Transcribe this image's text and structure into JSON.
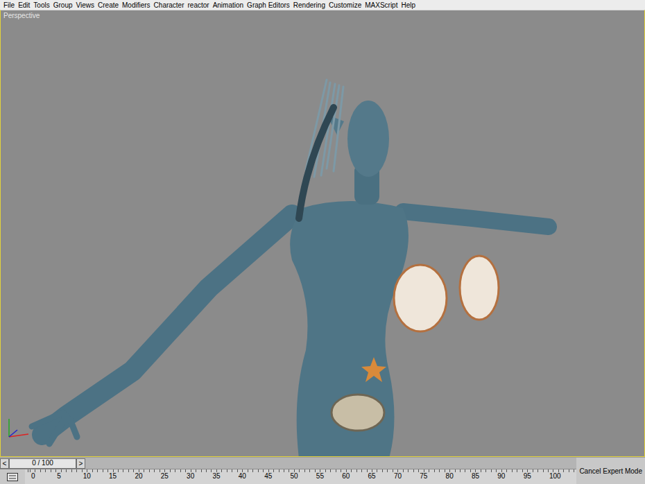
{
  "menu": [
    "File",
    "Edit",
    "Tools",
    "Group",
    "Views",
    "Create",
    "Modifiers",
    "Character",
    "reactor",
    "Animation",
    "Graph Editors",
    "Rendering",
    "Customize",
    "MAXScript",
    "Help"
  ],
  "viewport": {
    "label": "Perspective"
  },
  "time_slider": {
    "prev": "<",
    "reading": "0 / 100",
    "next": ">",
    "level": 0
  },
  "track_bar": {
    "labels": [
      "0",
      "5",
      "10",
      "15",
      "20",
      "25",
      "30",
      "35",
      "40",
      "45",
      "50",
      "55",
      "60",
      "65",
      "70",
      "75",
      "80",
      "85",
      "90",
      "95",
      "100"
    ]
  },
  "buttons": [
    "Cancel Expert Mode"
  ]
}
